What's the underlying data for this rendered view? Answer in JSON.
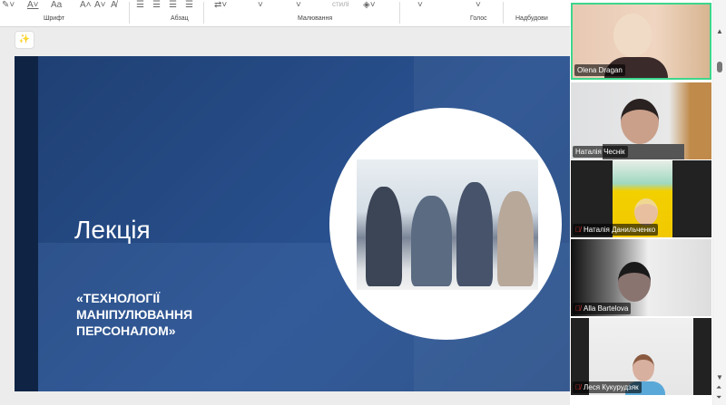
{
  "ribbon": {
    "groups": [
      "Шрифт",
      "Абзац",
      "Малювання",
      "Голос",
      "Надбудови"
    ],
    "styles_label": "стилі",
    "font_size_label": "Aa"
  },
  "slide": {
    "title": "Лекція",
    "subtitle": "«ТЕХНОЛОГІЇ МАНІПУЛЮВАННЯ ПЕРСОНАЛОМ»"
  },
  "participants": [
    {
      "name": "Olena Dragan",
      "muted": false,
      "active": true
    },
    {
      "name": "Наталія Чеснік",
      "muted": false,
      "active": false
    },
    {
      "name": "Наталія Данильченко",
      "muted": true,
      "active": false
    },
    {
      "name": "Alla Bartelova",
      "muted": true,
      "active": false
    },
    {
      "name": "Леся Кукурудзяк",
      "muted": true,
      "active": false
    }
  ],
  "colors": {
    "active_border": "#3dd68c",
    "slide_bg": "#2a5291",
    "muted_mic": "#e33333"
  }
}
